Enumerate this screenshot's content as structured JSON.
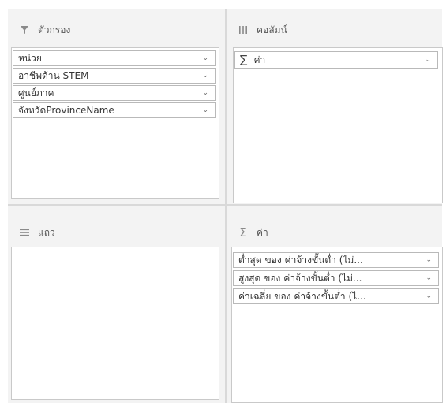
{
  "filters": {
    "title": "ตัวกรอง",
    "icon": "filter-icon",
    "items": [
      {
        "label": "หน่วย"
      },
      {
        "label": "อาชีพด้าน STEM"
      },
      {
        "label": "ศูนย์ภาค"
      },
      {
        "label": "จังหวัดProvinceName"
      }
    ]
  },
  "columns": {
    "title": "คอลัมน์",
    "icon": "columns-icon",
    "items": [
      {
        "symbol": "∑",
        "label": "ค่า"
      }
    ]
  },
  "rows": {
    "title": "แถว",
    "icon": "rows-icon",
    "items": []
  },
  "values": {
    "title": "ค่า",
    "icon": "sigma-icon",
    "header_symbol": "Σ",
    "items": [
      {
        "label": "ต่ำสุด ของ ค่าจ้างขั้นต่ำ (ไม่..."
      },
      {
        "label": "สูงสุด ของ ค่าจ้างขั้นต่ำ (ไม่..."
      },
      {
        "label": "ค่าเฉลี่ย ของ ค่าจ้างขั้นต่ำ (ไ..."
      }
    ]
  }
}
